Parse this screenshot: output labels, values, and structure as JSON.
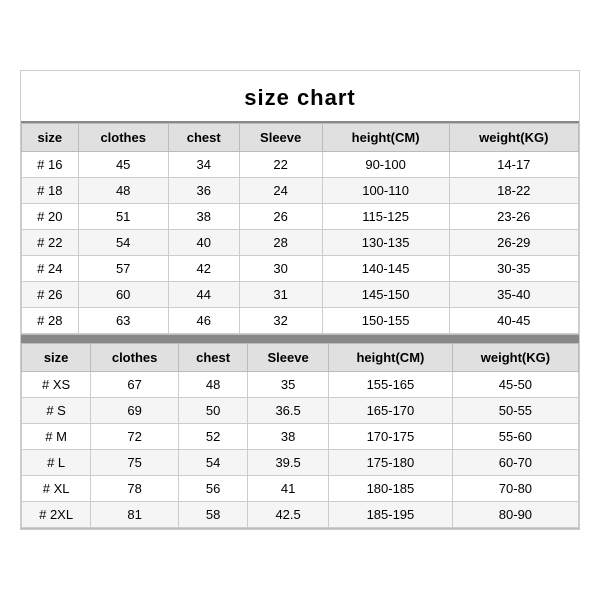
{
  "title": "size chart",
  "section1": {
    "headers": [
      "size",
      "clothes",
      "chest",
      "Sleeve",
      "height(CM)",
      "weight(KG)"
    ],
    "rows": [
      [
        "# 16",
        "45",
        "34",
        "22",
        "90-100",
        "14-17"
      ],
      [
        "# 18",
        "48",
        "36",
        "24",
        "100-110",
        "18-22"
      ],
      [
        "# 20",
        "51",
        "38",
        "26",
        "115-125",
        "23-26"
      ],
      [
        "# 22",
        "54",
        "40",
        "28",
        "130-135",
        "26-29"
      ],
      [
        "# 24",
        "57",
        "42",
        "30",
        "140-145",
        "30-35"
      ],
      [
        "# 26",
        "60",
        "44",
        "31",
        "145-150",
        "35-40"
      ],
      [
        "# 28",
        "63",
        "46",
        "32",
        "150-155",
        "40-45"
      ]
    ]
  },
  "section2": {
    "headers": [
      "size",
      "clothes",
      "chest",
      "Sleeve",
      "height(CM)",
      "weight(KG)"
    ],
    "rows": [
      [
        "# XS",
        "67",
        "48",
        "35",
        "155-165",
        "45-50"
      ],
      [
        "# S",
        "69",
        "50",
        "36.5",
        "165-170",
        "50-55"
      ],
      [
        "# M",
        "72",
        "52",
        "38",
        "170-175",
        "55-60"
      ],
      [
        "# L",
        "75",
        "54",
        "39.5",
        "175-180",
        "60-70"
      ],
      [
        "# XL",
        "78",
        "56",
        "41",
        "180-185",
        "70-80"
      ],
      [
        "# 2XL",
        "81",
        "58",
        "42.5",
        "185-195",
        "80-90"
      ]
    ]
  }
}
